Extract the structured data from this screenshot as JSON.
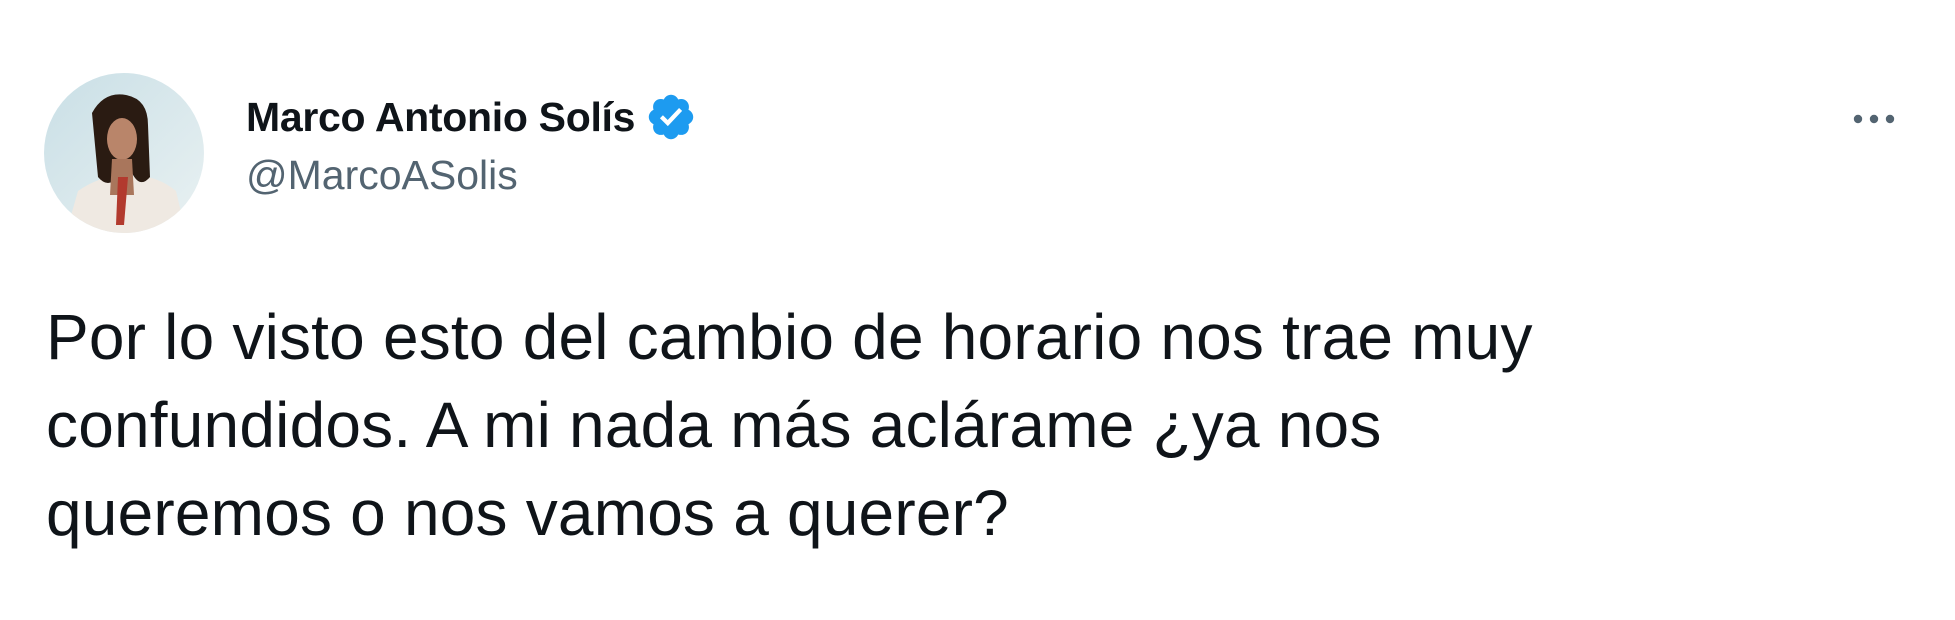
{
  "tweet": {
    "author": {
      "display_name": "Marco Antonio Solís",
      "handle": "@MarcoASolis",
      "verified": true,
      "avatar_icon": "profile-photo"
    },
    "more_icon": "more-horizontal-icon",
    "text_lines": [
      "Por lo visto esto del cambio de horario nos trae muy",
      "confundidos. A mi nada más aclárame ¿ya nos",
      "queremos o nos vamos a querer?"
    ]
  },
  "colors": {
    "text_primary": "#0f1419",
    "text_secondary": "#536471",
    "verified_blue": "#1d9bf0",
    "background": "#ffffff"
  }
}
